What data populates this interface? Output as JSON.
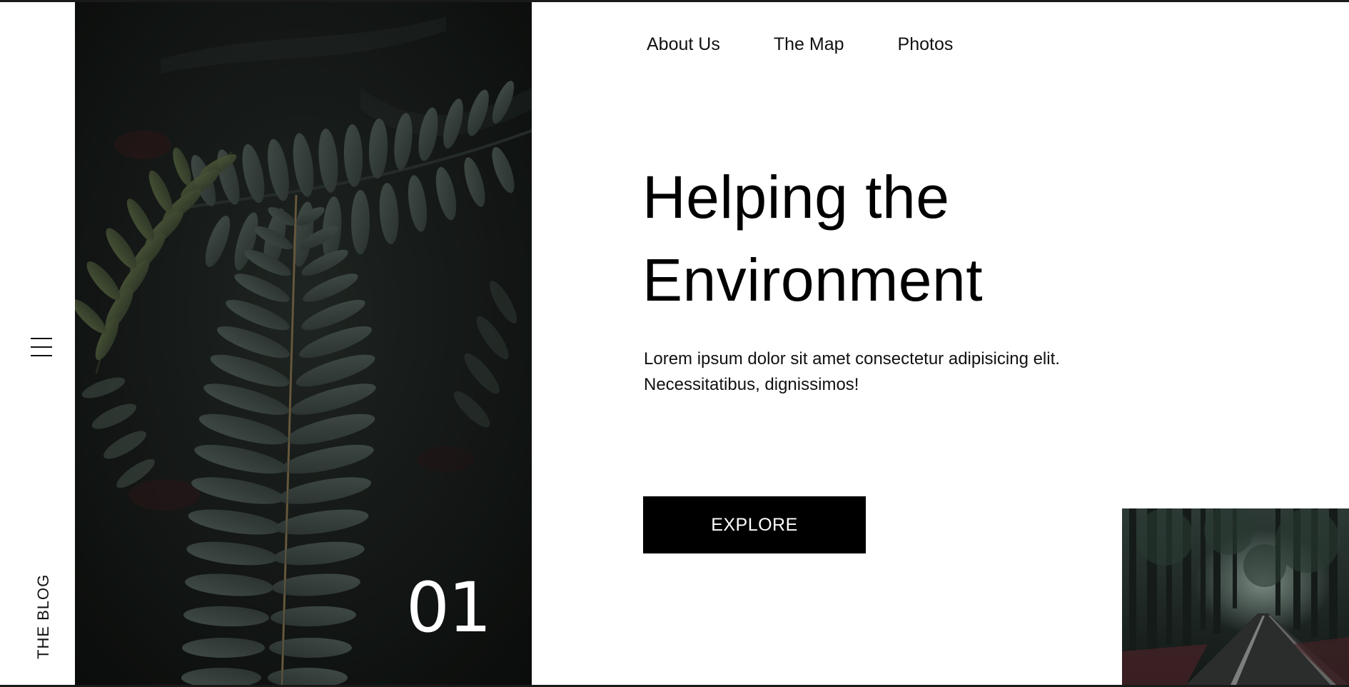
{
  "rail": {
    "menu_icon": "hamburger-menu-icon",
    "label": "THE BLOG"
  },
  "hero": {
    "image": "dark fern leaves photo",
    "slide_number": "01"
  },
  "nav": {
    "items": [
      {
        "label": "About Us"
      },
      {
        "label": "The Map"
      },
      {
        "label": "Photos"
      }
    ]
  },
  "main": {
    "headline_line1": "Helping the",
    "headline_line2": "Environment",
    "lede_line1": "Lorem ipsum dolor sit amet consectetur adipisicing elit.",
    "lede_line2": "Necessitatibus, dignissimos!",
    "cta_label": "EXPLORE"
  },
  "thumbnail": {
    "image": "forest road photo"
  },
  "colors": {
    "background": "#ffffff",
    "text": "#000000",
    "button_bg": "#000000",
    "button_text": "#ffffff",
    "hero_dark": "#151816",
    "fern_green": "#3b4642"
  }
}
